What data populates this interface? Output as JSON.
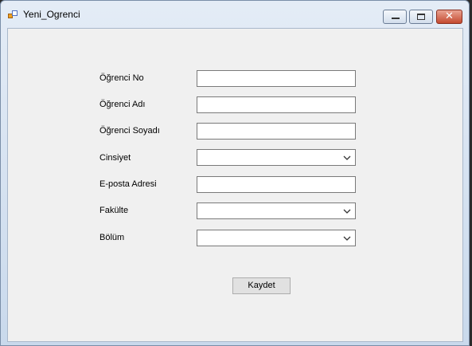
{
  "window": {
    "title": "Yeni_Ogrenci",
    "controls": {
      "minimize": "minimize",
      "maximize": "maximize",
      "close": "✕"
    }
  },
  "form": {
    "ogrenci_no": {
      "label": "Öğrenci No",
      "value": ""
    },
    "ogrenci_adi": {
      "label": "Öğrenci Adı",
      "value": ""
    },
    "ogrenci_soyadi": {
      "label": "Öğrenci Soyadı",
      "value": ""
    },
    "cinsiyet": {
      "label": "Cinsiyet",
      "selected": ""
    },
    "eposta": {
      "label": "E-posta Adresi",
      "value": ""
    },
    "fakulte": {
      "label": "Fakülte",
      "selected": ""
    },
    "bolum": {
      "label": "Bölüm",
      "selected": ""
    },
    "save_label": "Kaydet"
  },
  "icons": {
    "app": "app-form-icon",
    "dropdown": "chevron-down-icon"
  }
}
